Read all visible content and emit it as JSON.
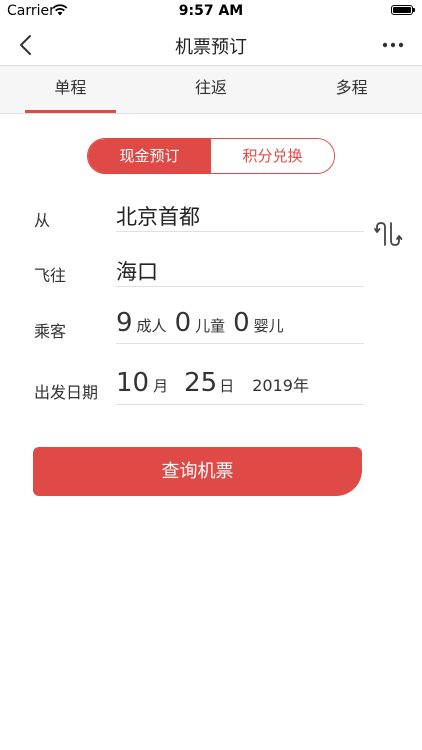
{
  "status": {
    "carrier": "Carrier",
    "time": "9:57 AM"
  },
  "nav": {
    "title": "机票预订"
  },
  "tabs": [
    {
      "label": "单程"
    },
    {
      "label": "往返"
    },
    {
      "label": "多程"
    }
  ],
  "payment": {
    "cash": "现金预订",
    "points": "积分兑换"
  },
  "form": {
    "from_label": "从",
    "from_city": "北京首都",
    "to_label": "飞往",
    "to_city": "海口",
    "passenger_label": "乘客",
    "adults": "9",
    "adults_unit": "成人",
    "children": "0",
    "children_unit": "儿童",
    "infants": "0",
    "infants_unit": "婴儿",
    "date_label": "出发日期",
    "month": "10",
    "month_unit": "月",
    "day": "25",
    "day_unit": "日",
    "year": "2019年"
  },
  "search_label": "查询机票",
  "colors": {
    "accent": "#e04a46"
  }
}
